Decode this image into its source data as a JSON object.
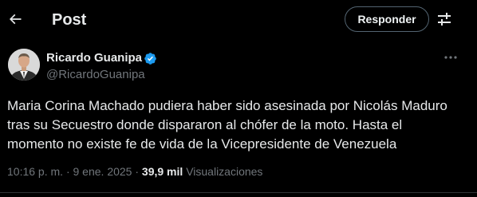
{
  "header": {
    "title": "Post",
    "reply_label": "Responder"
  },
  "author": {
    "name": "Ricardo Guanipa",
    "handle": "@RicardoGuanipa",
    "verified": true
  },
  "tweet": {
    "lines": [
      "Maria Corina Machado pudiera haber sido asesinada por Nicolás Maduro",
      "tras su Secuestro donde dispararon al chófer de la moto. Hasta el",
      "momento no existe fe de vida de la Vicepresidente de Venezuela"
    ]
  },
  "meta": {
    "time": "10:16 p. m.",
    "separator": "·",
    "date": "9 ene. 2025",
    "views_count": "39,9 mil",
    "views_label": "Visualizaciones"
  },
  "colors": {
    "background": "#000000",
    "text_primary": "#e7e9ea",
    "text_secondary": "#71767b",
    "verified_badge": "#1d9bf0",
    "border": "#2f3336"
  },
  "icons": {
    "back": "arrow-left-icon",
    "filter": "sliders-icon",
    "verified": "verified-badge-icon",
    "more": "more-horizontal-icon"
  }
}
